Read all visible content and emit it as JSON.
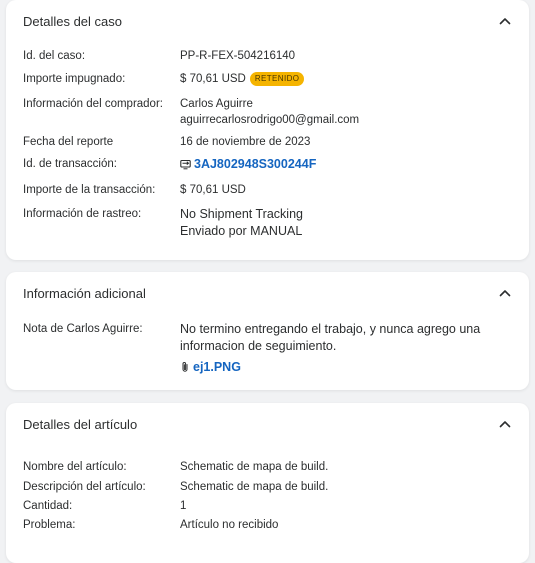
{
  "case_details": {
    "title": "Detalles del caso",
    "rows": [
      {
        "label": "Id. del caso:",
        "value": "PP-R-FEX-504216140"
      },
      {
        "label": "Importe impugnado:",
        "value": "$ 70,61 USD",
        "badge": "RETENIDO"
      },
      {
        "label": "Información del comprador:",
        "value": "Carlos Aguirre",
        "value2": "aguirrecarlosrodrigo00@gmail.com"
      },
      {
        "label": "Fecha del reporte",
        "value": "16 de noviembre de 2023"
      },
      {
        "label": "Id. de transacción:",
        "value": "3AJ802948S300244F"
      },
      {
        "label": "Importe de la transacción:",
        "value": "$ 70,61 USD"
      },
      {
        "label": "Información de rastreo:",
        "value": "No Shipment Tracking",
        "value2": "Enviado por MANUAL"
      }
    ]
  },
  "additional_info": {
    "title": "Información adicional",
    "note_label": "Nota de Carlos Aguirre:",
    "note_line1": "No termino entregando el trabajo, y nunca agrego una",
    "note_line2": "informacion de seguimiento.",
    "attachment": "ej1.PNG"
  },
  "item_details": {
    "title": "Detalles del artículo",
    "rows": [
      {
        "label": "Nombre del artículo:",
        "value": "Schematic de mapa de build."
      },
      {
        "label": "Descripción del artículo:",
        "value": "Schematic de mapa de build."
      },
      {
        "label": "Cantidad:",
        "value": "1"
      },
      {
        "label": "Problema:",
        "value": "Artículo no recibido"
      }
    ]
  },
  "colors": {
    "accent_link": "#1565c0",
    "badge_bg": "#f5b400",
    "page_bg": "#f1f2f4"
  },
  "icons": [
    "chevron-up-icon",
    "transaction-icon",
    "paperclip-icon"
  ]
}
